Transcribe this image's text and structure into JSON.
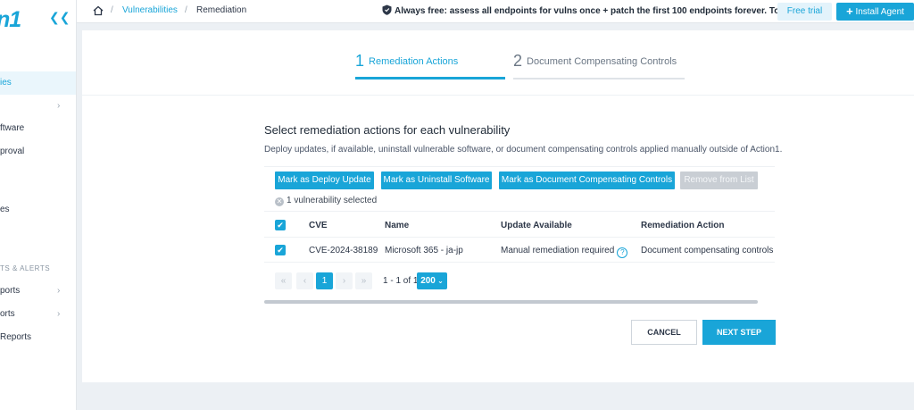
{
  "sidebar": {
    "logo": "n1",
    "items": [
      {
        "label": "ies",
        "active": true
      },
      {
        "label": "",
        "has_chevron": true
      },
      {
        "label": "ftware"
      },
      {
        "label": "proval"
      },
      {
        "label": "es"
      }
    ],
    "section_label": "TS & ALERTS",
    "report_items": [
      {
        "label": "ports",
        "has_chevron": true
      },
      {
        "label": "orts",
        "has_chevron": true
      },
      {
        "label": "Reports"
      }
    ]
  },
  "topbar": {
    "breadcrumb": {
      "sep1": "/",
      "link": "Vulnerabilities",
      "sep2": "/",
      "current": "Remediation"
    },
    "promo": "Always free: assess all endpoints for vulns once + patch the first 100 endpoints forever. To test more:",
    "free_trial": "Free trial",
    "install_agent": "Install Agent"
  },
  "steps": [
    {
      "num": "1",
      "label": "Remediation Actions",
      "active": true
    },
    {
      "num": "2",
      "label": "Document Compensating Controls",
      "active": false
    }
  ],
  "main": {
    "title": "Select remediation actions for each vulnerability",
    "subtitle": "Deploy updates, if available, uninstall vulnerable software, or document compensating controls applied manually outside of Action1.",
    "actions": {
      "deploy": "Mark as Deploy Update",
      "uninstall": "Mark as Uninstall Software",
      "document": "Mark as Document Compensating Controls",
      "remove": "Remove from List"
    },
    "selected_text": "1 vulnerability selected",
    "columns": {
      "cve": "CVE",
      "name": "Name",
      "update": "Update Available",
      "action": "Remediation Action"
    },
    "rows": [
      {
        "cve": "CVE-2024-38189",
        "name": "Microsoft 365 - ja-jp",
        "update": "Manual remediation required",
        "action": "Document compensating controls"
      }
    ],
    "pagination": {
      "current": "1",
      "range": "1 - 1 of 1",
      "page_size": "200"
    },
    "cancel": "CANCEL",
    "next": "NEXT STEP"
  },
  "colors": {
    "accent": "#19a5d8",
    "disabled": "#c9ced4",
    "background": "#ecf0f4"
  }
}
